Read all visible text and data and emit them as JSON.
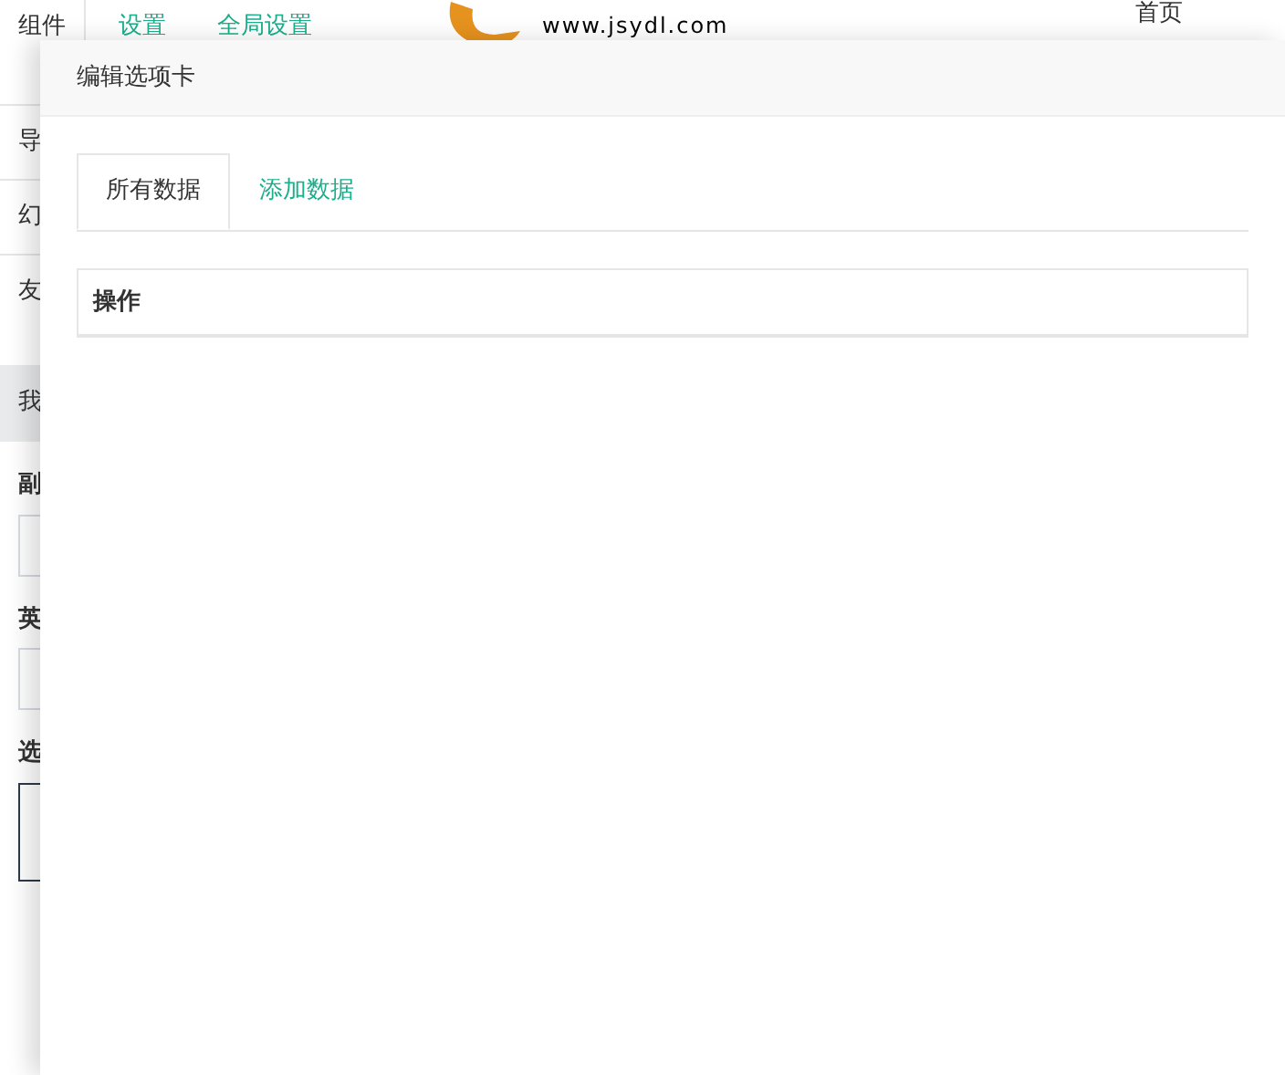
{
  "topbar": {
    "items": [
      {
        "label": "组件",
        "kind": "plain"
      },
      {
        "label": "设置",
        "kind": "link"
      },
      {
        "label": "全局设置",
        "kind": "link"
      }
    ],
    "logo_url": "www.jsydl.com",
    "nav": [
      "首页"
    ]
  },
  "sidebar": {
    "items": [
      {
        "label": "导",
        "selected": false
      },
      {
        "label": "幻",
        "selected": false
      },
      {
        "label": "友",
        "selected": false
      },
      {
        "label": "我",
        "selected": true
      }
    ]
  },
  "form": {
    "fields": [
      {
        "label": "副",
        "kind": "input"
      },
      {
        "label": "英",
        "kind": "input"
      },
      {
        "label": "选",
        "kind": "textarea"
      }
    ]
  },
  "modal": {
    "title": "编辑选项卡",
    "tabs": [
      {
        "label": "所有数据",
        "selected": true
      },
      {
        "label": "添加数据",
        "selected": false
      }
    ],
    "table": {
      "columns": [
        "操作"
      ]
    }
  }
}
